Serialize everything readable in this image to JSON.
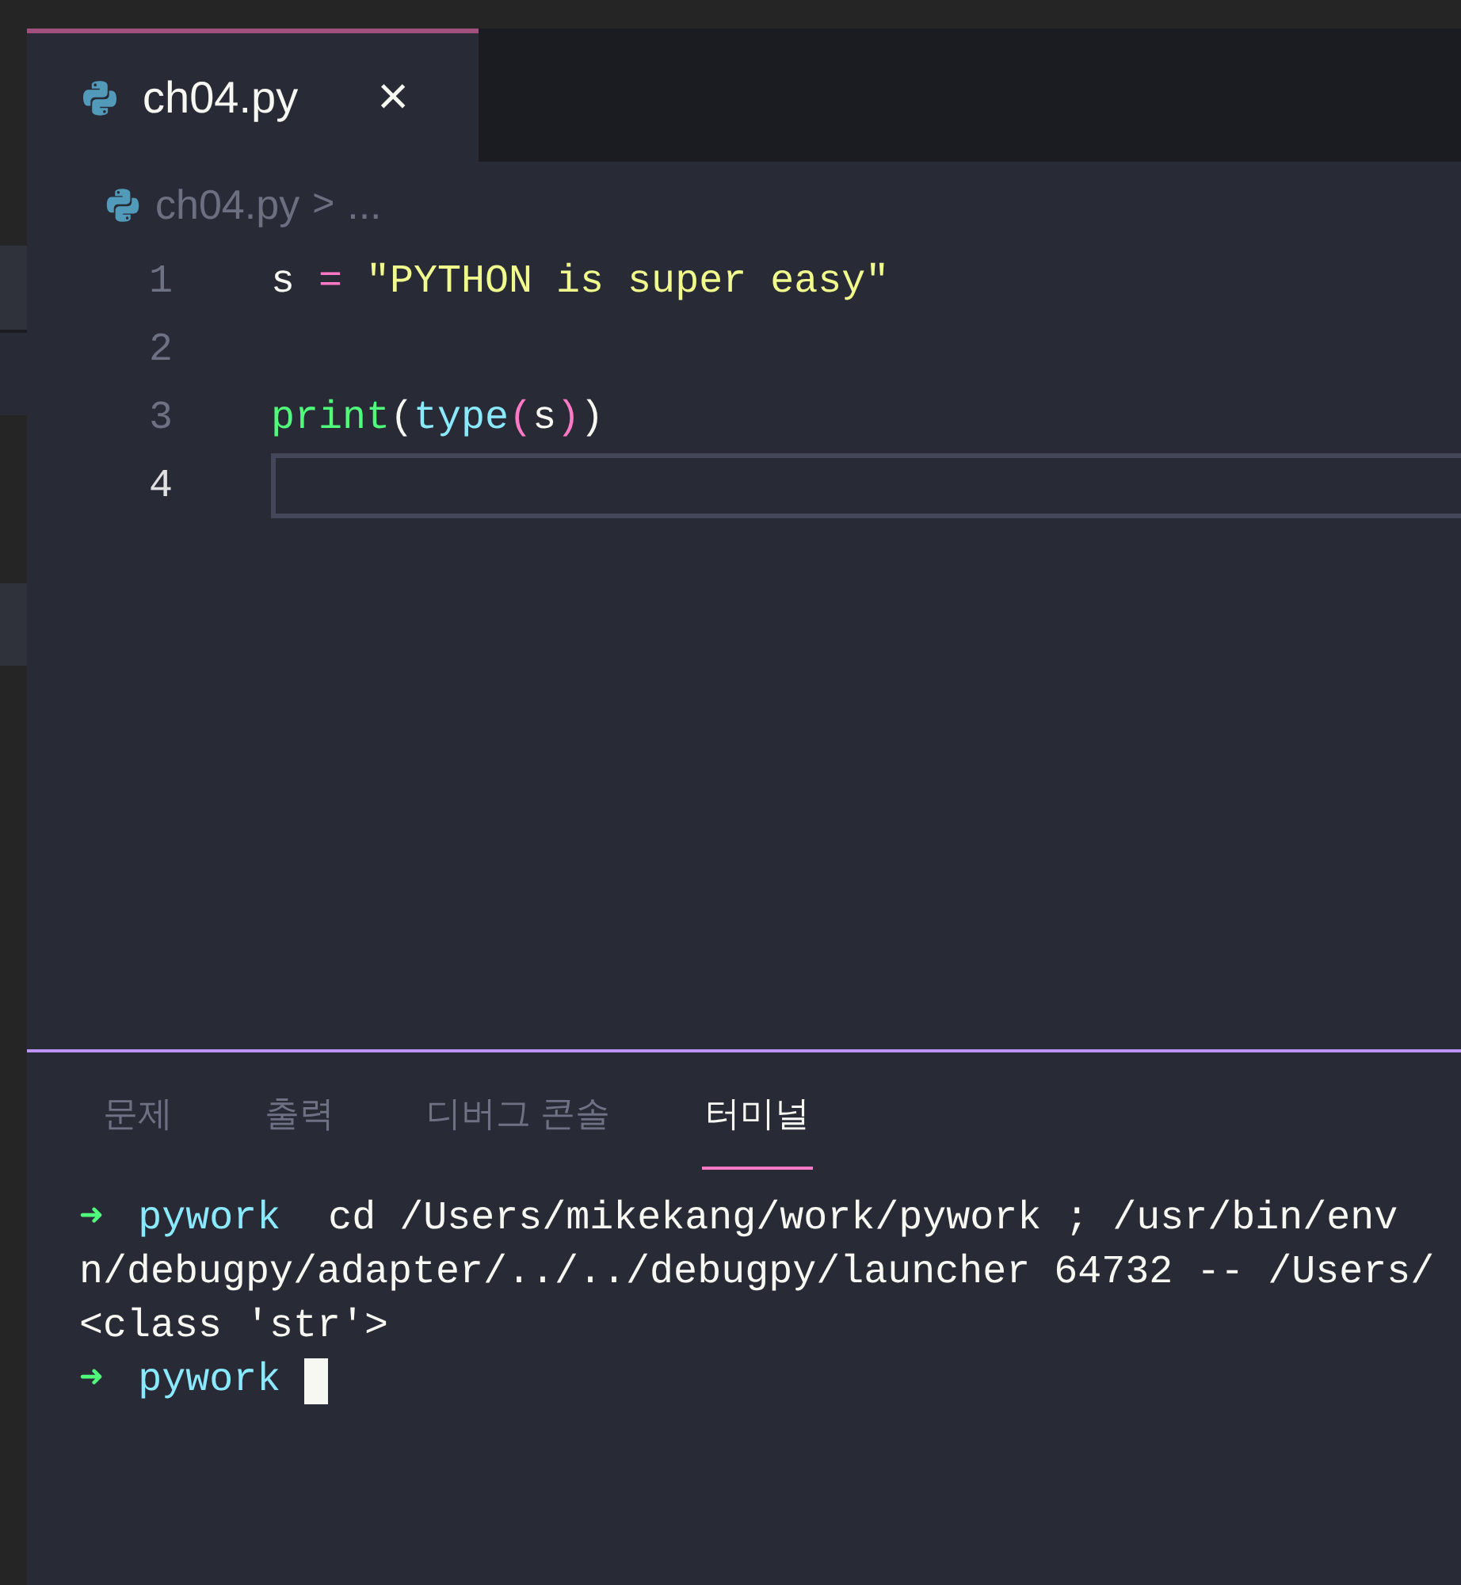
{
  "tabs": [
    {
      "label": "ch04.py",
      "selected": true,
      "close": "×"
    }
  ],
  "breadcrumb": {
    "file": "ch04.py",
    "separator": ">",
    "rest": "..."
  },
  "editor": {
    "lines": [
      {
        "number": "1",
        "current": false,
        "tokens": [
          {
            "kind": "var",
            "text": "s"
          },
          {
            "kind": "op",
            "text": "="
          },
          {
            "kind": "string",
            "text": "\"PYTHON is super easy\""
          }
        ]
      },
      {
        "number": "2",
        "current": false
      },
      {
        "number": "3",
        "current": false,
        "tokens": [
          {
            "kind": "func",
            "text": "print"
          },
          {
            "kind": "paren",
            "text": "("
          },
          {
            "kind": "builtin",
            "text": "type"
          },
          {
            "kind": "paren2",
            "text": "("
          },
          {
            "kind": "var",
            "text": "s"
          },
          {
            "kind": "paren2",
            "text": ")"
          },
          {
            "kind": "paren",
            "text": ")"
          }
        ]
      },
      {
        "number": "4",
        "current": true
      }
    ]
  },
  "panel": {
    "tabs": [
      {
        "label": "문제",
        "selected": false
      },
      {
        "label": "출력",
        "selected": false
      },
      {
        "label": "디버그 콘솔",
        "selected": false
      },
      {
        "label": "터미널",
        "selected": true
      }
    ],
    "terminal": [
      [
        {
          "kind": "arrow",
          "text": "➜"
        },
        {
          "kind": "dir",
          "text": "pywork"
        },
        {
          "kind": "text",
          "text": "cd /Users/mikekang/work/pywork ; /usr/bin/env"
        }
      ],
      [
        {
          "kind": "text",
          "text": "n/debugpy/adapter/../../debugpy/launcher 64732 -- /Users/"
        }
      ],
      [
        {
          "kind": "text",
          "text": "<class 'str'>"
        }
      ],
      [
        {
          "kind": "arrow",
          "text": "➜"
        },
        {
          "kind": "dir",
          "text": "pywork"
        },
        {
          "kind": "cursor"
        }
      ]
    ]
  }
}
